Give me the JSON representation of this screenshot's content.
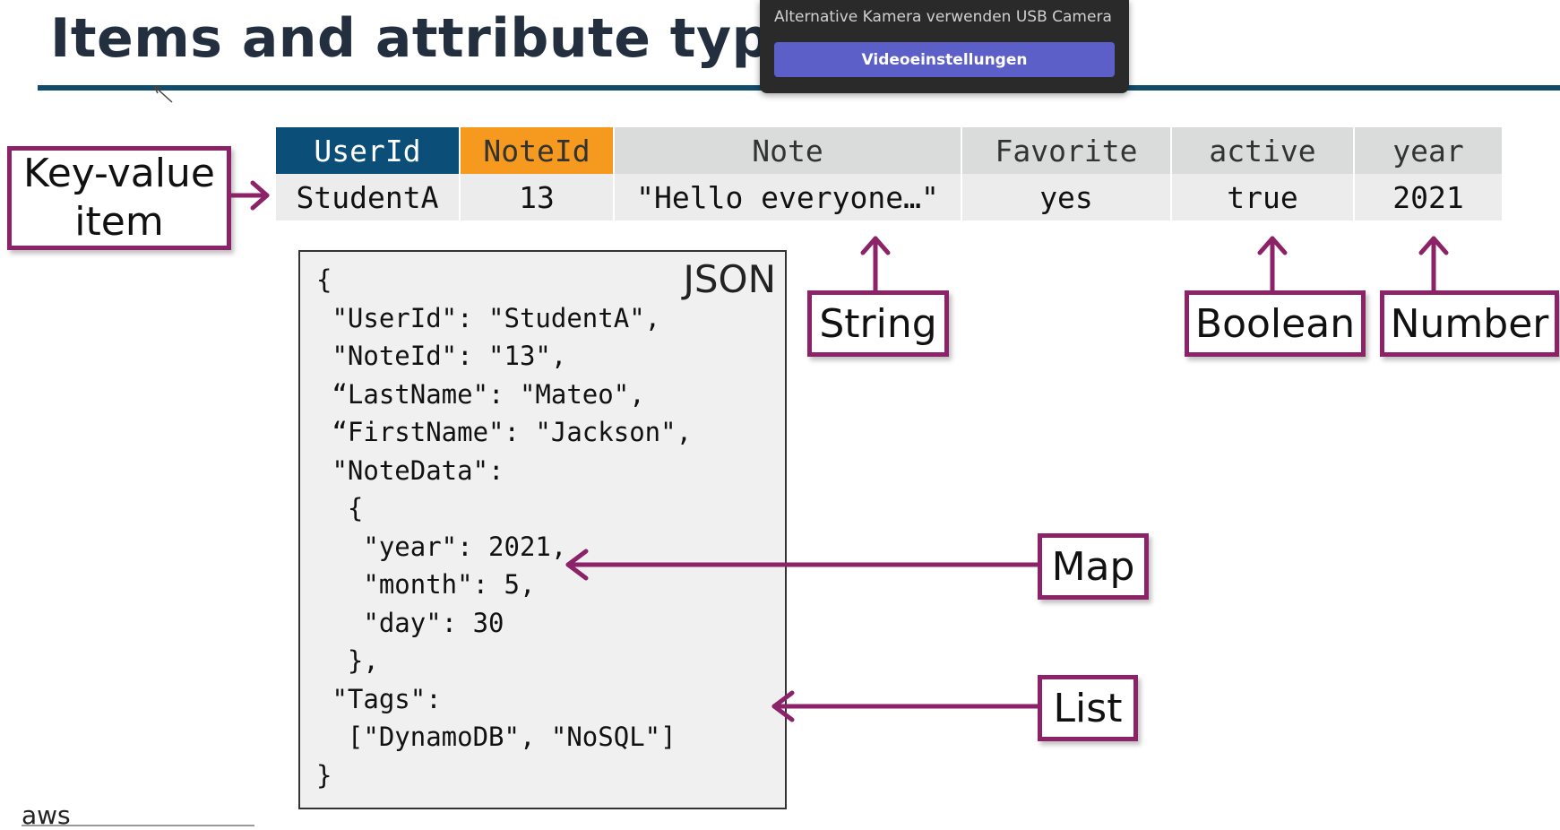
{
  "slide": {
    "title": "Items and attribute types",
    "kv_label_line1": "Key-value",
    "kv_label_line2": "item",
    "json_label": "JSON",
    "logo_text": "aws"
  },
  "popup": {
    "text": "Alternative Kamera verwenden USB Camera",
    "button_label": "Videoeinstellungen"
  },
  "table": {
    "headers": [
      "UserId",
      "NoteId",
      "Note",
      "Favorite",
      "active",
      "year"
    ],
    "row": [
      "StudentA",
      "13",
      "\"Hello everyone…\"",
      "yes",
      "true",
      "2021"
    ]
  },
  "json_lines": [
    "{",
    " \"UserId\": \"StudentA\",",
    " \"NoteId\": \"13\",",
    " “LastName\": \"Mateo\",",
    " “FirstName\": \"Jackson\",",
    " \"NoteData\":",
    "  {",
    "   \"year\": 2021,",
    "   \"month\": 5,",
    "   \"day\": 30",
    "  },",
    " \"Tags\":",
    "  [\"DynamoDB\", \"NoSQL\"]",
    "}"
  ],
  "type_labels": {
    "string": "String",
    "boolean": "Boolean",
    "number": "Number",
    "map": "Map",
    "list": "List"
  },
  "colors": {
    "title": "#232f3e",
    "rule": "#0f4c6e",
    "userid_header_bg": "#0b4f78",
    "noteid_header_bg": "#f59a1e",
    "header_bg": "#d9dcdb",
    "cell_bg": "#ececec",
    "accent": "#8c2268",
    "popup_bg": "#2a2a2a",
    "popup_button": "#5b5fc7"
  }
}
